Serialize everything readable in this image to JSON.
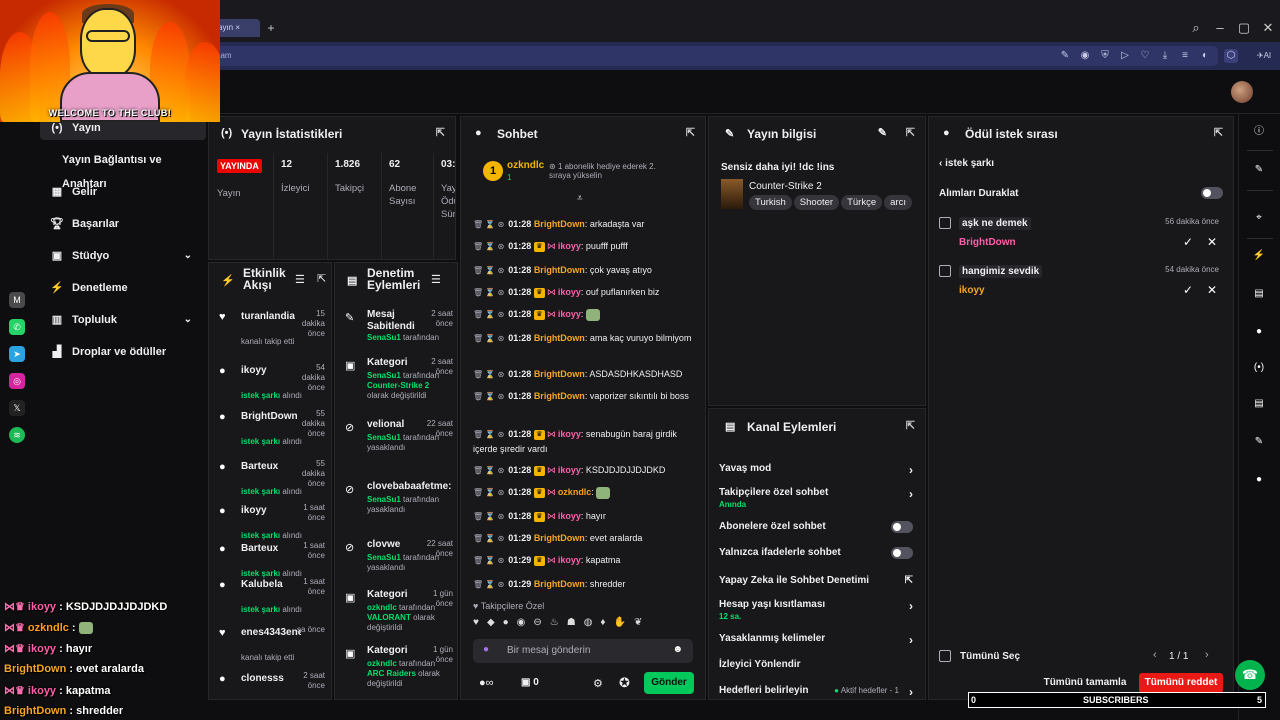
{
  "browser": {
    "tab_label": "ayın",
    "address_text": "eam",
    "ai_label": "AI"
  },
  "overlay": {
    "welcome_text": "WELCOME TO THE CLUB!"
  },
  "sidenav": {
    "items": [
      {
        "label": "Yayın",
        "icon": "broadcast-icon"
      },
      {
        "label": "Yayın Bağlantısı ve Anahtarı",
        "icon": ""
      },
      {
        "label": "Gelir",
        "icon": "revenue-icon"
      },
      {
        "label": "Başarılar",
        "icon": "trophy-icon"
      },
      {
        "label": "Stüdyo",
        "icon": "studio-icon"
      },
      {
        "label": "Denetleme",
        "icon": "moderation-icon"
      },
      {
        "label": "Topluluk",
        "icon": "community-icon"
      },
      {
        "label": "Droplar ve ödüller",
        "icon": "drops-icon"
      }
    ]
  },
  "stats": {
    "title": "Yayın İstatistikleri",
    "live_badge": "YAYINDA",
    "cells": [
      {
        "value": "",
        "label": "Yayın"
      },
      {
        "value": "12",
        "label": "İzleyici"
      },
      {
        "value": "1.826",
        "label": "Takipçi"
      },
      {
        "value": "62",
        "label": "Abone Sayısı"
      },
      {
        "value": "03:",
        "label": "Yay Ödü Sür"
      }
    ]
  },
  "activity": {
    "title": "Etkinlik Akışı",
    "rows": [
      {
        "name": "turanlandia",
        "time": "15 dakika önce",
        "sub": "kanalı takip etti",
        "subhl": ""
      },
      {
        "name": "ikoyy",
        "time": "54 dakika önce",
        "sub": "alındı",
        "subhl": "istek şarkı"
      },
      {
        "name": "BrightDown",
        "time": "55 dakika önce",
        "sub": "alındı",
        "subhl": "istek şarkı"
      },
      {
        "name": "Barteux",
        "time": "55 dakika önce",
        "sub": "alındı",
        "subhl": "istek şarkı"
      },
      {
        "name": "ikoyy",
        "time": "1 saat önce",
        "sub": "alındı",
        "subhl": "istek şarkı"
      },
      {
        "name": "Barteux",
        "time": "1 saat önce",
        "sub": "alındı",
        "subhl": "istek şarkı"
      },
      {
        "name": "Kalubela",
        "time": "1 saat önce",
        "sub": "alındı",
        "subhl": "istek şarkı"
      },
      {
        "name": "enes4343enes",
        "time": "sa önce",
        "sub": "kanalı takip etti",
        "subhl": ""
      },
      {
        "name": "clonesss",
        "time": "2 saat önce",
        "sub": "",
        "subhl": ""
      }
    ]
  },
  "modactions": {
    "title": "Denetim Eylemleri",
    "rows": [
      {
        "name": "Mesaj Sabitlendi",
        "time": "2 saat önce",
        "who": "SenaSu1",
        "by": "tarafından",
        "extra": "",
        "tail": ""
      },
      {
        "name": "Kategori",
        "time": "2 saat önce",
        "who": "SenaSu1",
        "by": "tarafından",
        "extra": "Counter-Strike 2",
        "tail": "olarak değiştirildi"
      },
      {
        "name": "velional",
        "time": "22 saat önce",
        "who": "SenaSu1",
        "by": "tarafından",
        "extra": "",
        "tail": "yasaklandı"
      },
      {
        "name": "clovebabaafetme:",
        "time": "",
        "who": "SenaSu1",
        "by": "tarafından",
        "extra": "",
        "tail": "yasaklandı"
      },
      {
        "name": "clovwe",
        "time": "22 saat önce",
        "who": "SenaSu1",
        "by": "tarafından",
        "extra": "",
        "tail": "yasaklandı"
      },
      {
        "name": "Kategori",
        "time": "1 gün önce",
        "who": "ozkndlc",
        "by": "tarafından",
        "extra": "VALORANT",
        "tail": "olarak değiştirildi"
      },
      {
        "name": "Kategori",
        "time": "1 gün önce",
        "who": "ozkndlc",
        "by": "tarafından",
        "extra": "ARC Raiders",
        "tail": "olarak değiştirildi"
      }
    ]
  },
  "chat": {
    "title": "Sohbet",
    "pinned_user": "ozkndlc",
    "pinned_count": "1",
    "pinned_text": "1 abonelik hediye ederek 2. sıraya yükselin",
    "lines": [
      {
        "time": "01:28",
        "user": "BrightDown",
        "cls": "u-bd",
        "badges": "",
        "msg": "arkadaşta var"
      },
      {
        "time": "01:28",
        "user": "ikoyy",
        "cls": "u-ik",
        "badges": "crown",
        "msg": "puufff pufff"
      },
      {
        "time": "01:28",
        "user": "BrightDown",
        "cls": "u-bd",
        "badges": "",
        "msg": "çok yavaş atıyo"
      },
      {
        "time": "01:28",
        "user": "ikoyy",
        "cls": "u-ik",
        "badges": "crown",
        "msg": "ouf puflanırken biz"
      },
      {
        "time": "01:28",
        "user": "ikoyy",
        "cls": "u-ik",
        "badges": "crown",
        "msg": ""
      },
      {
        "time": "01:28",
        "user": "BrightDown",
        "cls": "u-bd",
        "badges": "",
        "msg": "ama kaç vuruyo bilmiyom"
      },
      {
        "time": "01:28",
        "user": "BrightDown",
        "cls": "u-bd",
        "badges": "",
        "msg": "ASDASDHKASDHASD"
      },
      {
        "time": "01:28",
        "user": "BrightDown",
        "cls": "u-bd",
        "badges": "",
        "msg": "vaporizer sıkıntılı bi boss"
      },
      {
        "time": "01:28",
        "user": "ikoyy",
        "cls": "u-ik",
        "badges": "crown",
        "msg": "senabugün baraj girdik içerde şıredir vardı"
      },
      {
        "time": "01:28",
        "user": "ikoyy",
        "cls": "u-ik",
        "badges": "crown",
        "msg": "KSDJDJDJJDJDKD"
      },
      {
        "time": "01:28",
        "user": "ozkndlc",
        "cls": "u-oz",
        "badges": "crown",
        "msg": ""
      },
      {
        "time": "01:28",
        "user": "ikoyy",
        "cls": "u-ik",
        "badges": "crown",
        "msg": "hayır"
      },
      {
        "time": "01:29",
        "user": "BrightDown",
        "cls": "u-bd",
        "badges": "",
        "msg": "evet aralarda"
      },
      {
        "time": "01:29",
        "user": "ikoyy",
        "cls": "u-ik",
        "badges": "crown",
        "msg": "kapatma"
      },
      {
        "time": "01:29",
        "user": "BrightDown",
        "cls": "u-bd",
        "badges": "",
        "msg": "shredder"
      }
    ],
    "followers_label": "Takipçilere Özel",
    "input_placeholder": "Bir mesaj gönderin",
    "points": "0",
    "send_label": "Gönder"
  },
  "streaminfo": {
    "title": "Yayın bilgisi",
    "stream_title": "Sensiz daha iyi! !dc !ins",
    "game": "Counter-Strike 2",
    "tags": [
      "Turkish",
      "Shooter",
      "Türkçe",
      "arcı"
    ]
  },
  "channel_actions": {
    "title": "Kanal Eylemleri",
    "rows": [
      {
        "label": "Yavaş mod",
        "sub": "",
        "control": "chevron"
      },
      {
        "label": "Takipçilere özel sohbet",
        "sub": "Anında",
        "control": "chevron"
      },
      {
        "label": "Abonelere özel sohbet",
        "sub": "",
        "control": "toggle"
      },
      {
        "label": "Yalnızca ifadelerle sohbet",
        "sub": "",
        "control": "toggle"
      },
      {
        "label": "Yapay Zeka ile Sohbet Denetimi",
        "sub": "",
        "control": "external"
      },
      {
        "label": "Hesap yaşı kısıtlaması",
        "sub": "12 sa.",
        "control": "chevron"
      },
      {
        "label": "Yasaklanmış kelimeler",
        "sub": "",
        "control": "chevron"
      },
      {
        "label": "İzleyici Yönlendir",
        "sub": "",
        "control": ""
      },
      {
        "label": "Hedefleri belirleyin",
        "sub": "",
        "control": "chevron"
      }
    ],
    "goals_status": "Aktif hedefler - 1"
  },
  "rewards": {
    "title": "Ödül istek sırası",
    "back_label": "istek şarkı",
    "pause_label": "Alımları Duraklat",
    "requests": [
      {
        "text": "aşk ne demek",
        "time": "56 dakika önce",
        "user": "BrightDown",
        "color": "#ff5fa8"
      },
      {
        "text": "hangimiz sevdik",
        "time": "54 dakika önce",
        "user": "ikoyy",
        "color": "#f5a623"
      }
    ],
    "select_all": "Tümünü Seç",
    "pager": "1 / 1",
    "complete_all": "Tümünü tamamla",
    "reject_all": "Tümünü reddet"
  },
  "overlay_chat": [
    {
      "user": "ikoyy",
      "color": "#ff5fa8",
      "msg": "KSDJDJDJJDJDKD"
    },
    {
      "user": "ozkndlc",
      "color": "#ff9f1a",
      "msg": ""
    },
    {
      "user": "ikoyy",
      "color": "#ff5fa8",
      "msg": "hayır"
    },
    {
      "user": "BrightDown",
      "color": "#f5a623",
      "msg": "evet aralarda"
    },
    {
      "user": "ikoyy",
      "color": "#ff5fa8",
      "msg": "kapatma"
    },
    {
      "user": "BrightDown",
      "color": "#f5a623",
      "msg": "shredder"
    }
  ],
  "sub_bar": {
    "left": "0",
    "label": "SUBSCRIBERS",
    "right": "5"
  },
  "colors": {
    "accent_green": "#00c95b",
    "live_red": "#eb0400",
    "reject_red": "#e91916"
  }
}
